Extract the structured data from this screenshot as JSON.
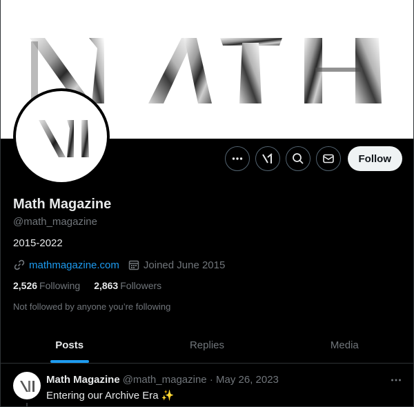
{
  "banner": {
    "wordmark": "MATH"
  },
  "avatar": {
    "monogram": "M"
  },
  "actions": {
    "more_icon": "ellipsis-icon",
    "grok_icon": "grok-icon",
    "search_icon": "search-icon",
    "message_icon": "envelope-icon",
    "follow_label": "Follow"
  },
  "profile": {
    "name": "Math Magazine",
    "handle": "@math_magazine",
    "bio": "2015-2022",
    "website": "mathmagazine.com",
    "joined": "Joined June 2015",
    "following_count": "2,526",
    "following_label": "Following",
    "followers_count": "2,863",
    "followers_label": "Followers",
    "not_followed_note": "Not followed by anyone you’re following"
  },
  "tabs": [
    {
      "label": "Posts",
      "active": true
    },
    {
      "label": "Replies",
      "active": false
    },
    {
      "label": "Media",
      "active": false
    }
  ],
  "post": {
    "name": "Math Magazine",
    "handle": "@math_magazine",
    "separator": "·",
    "date": "May 26, 2023",
    "text": "Entering our Archive Era ✨"
  },
  "colors": {
    "background": "#000000",
    "accent": "#1d9bf0",
    "muted": "#71767b",
    "text": "#e7e9ea"
  }
}
